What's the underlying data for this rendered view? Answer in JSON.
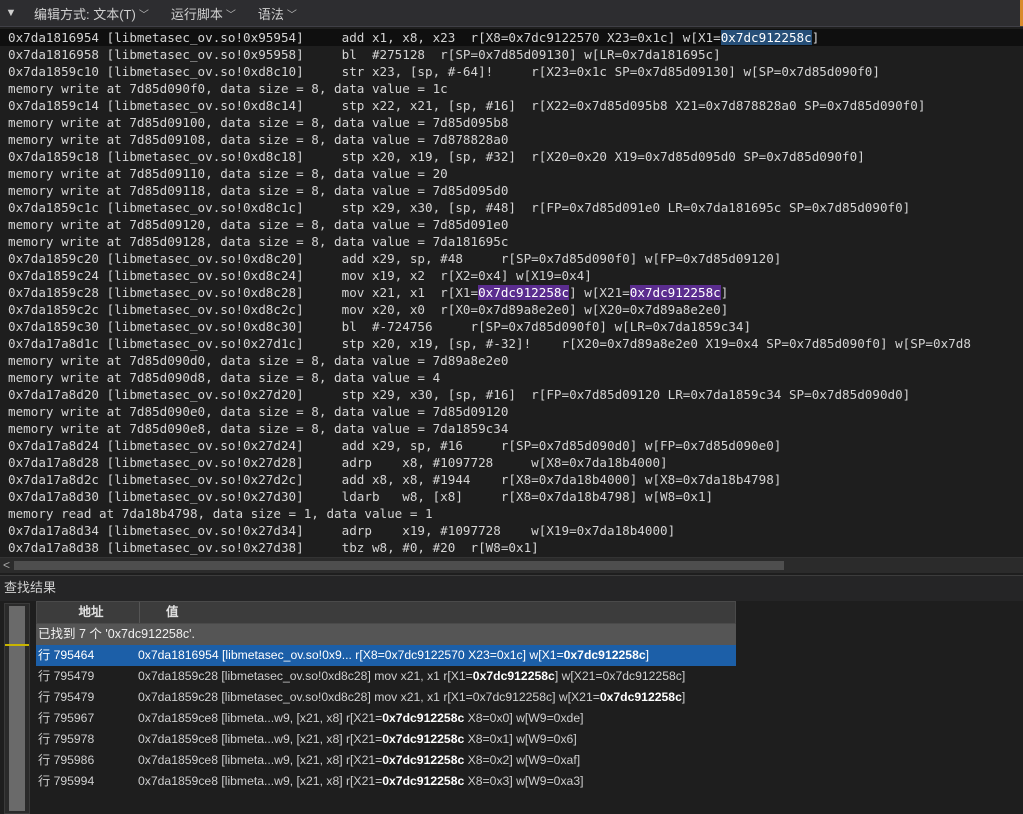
{
  "toolbar": {
    "collapse_glyph": "▼",
    "menus": [
      {
        "label": "编辑方式: 文本(T)",
        "icon": "chevron-down-icon"
      },
      {
        "label": "运行脚本",
        "icon": "chevron-down-icon"
      },
      {
        "label": "语法",
        "icon": "chevron-down-icon"
      }
    ]
  },
  "editor": {
    "lines": [
      {
        "pre": "0x7da1816954 [libmetasec_ov.so!0x95954]     add x1, x8, x23  r[X8=0x7dc9122570 X23=0x1c] w[X1=",
        "sel": "0x7dc912258c",
        "post": "]"
      },
      {
        "text": "0x7da1816958 [libmetasec_ov.so!0x95958]     bl  #275128  r[SP=0x7d85d09130] w[LR=0x7da181695c]"
      },
      {
        "text": "0x7da1859c10 [libmetasec_ov.so!0xd8c10]     str x23, [sp, #-64]!     r[X23=0x1c SP=0x7d85d09130] w[SP=0x7d85d090f0]"
      },
      {
        "text": "memory write at 7d85d090f0, data size = 8, data value = 1c"
      },
      {
        "text": "0x7da1859c14 [libmetasec_ov.so!0xd8c14]     stp x22, x21, [sp, #16]  r[X22=0x7d85d095b8 X21=0x7d878828a0 SP=0x7d85d090f0]"
      },
      {
        "text": "memory write at 7d85d09100, data size = 8, data value = 7d85d095b8"
      },
      {
        "text": "memory write at 7d85d09108, data size = 8, data value = 7d878828a0"
      },
      {
        "text": "0x7da1859c18 [libmetasec_ov.so!0xd8c18]     stp x20, x19, [sp, #32]  r[X20=0x20 X19=0x7d85d095d0 SP=0x7d85d090f0]"
      },
      {
        "text": "memory write at 7d85d09110, data size = 8, data value = 20"
      },
      {
        "text": "memory write at 7d85d09118, data size = 8, data value = 7d85d095d0"
      },
      {
        "text": "0x7da1859c1c [libmetasec_ov.so!0xd8c1c]     stp x29, x30, [sp, #48]  r[FP=0x7d85d091e0 LR=0x7da181695c SP=0x7d85d090f0]"
      },
      {
        "text": "memory write at 7d85d09120, data size = 8, data value = 7d85d091e0"
      },
      {
        "text": "memory write at 7d85d09128, data size = 8, data value = 7da181695c"
      },
      {
        "text": "0x7da1859c20 [libmetasec_ov.so!0xd8c20]     add x29, sp, #48     r[SP=0x7d85d090f0] w[FP=0x7d85d09120]"
      },
      {
        "text": "0x7da1859c24 [libmetasec_ov.so!0xd8c24]     mov x19, x2  r[X2=0x4] w[X19=0x4]"
      },
      {
        "pre": "0x7da1859c28 [libmetasec_ov.so!0xd8c28]     mov x21, x1  r[X1=",
        "match": "0x7dc912258c",
        "mid": "] w[X21=",
        "match2": "0x7dc912258c",
        "post": "]"
      },
      {
        "text": "0x7da1859c2c [libmetasec_ov.so!0xd8c2c]     mov x20, x0  r[X0=0x7d89a8e2e0] w[X20=0x7d89a8e2e0]"
      },
      {
        "text": "0x7da1859c30 [libmetasec_ov.so!0xd8c30]     bl  #-724756     r[SP=0x7d85d090f0] w[LR=0x7da1859c34]"
      },
      {
        "text": "0x7da17a8d1c [libmetasec_ov.so!0x27d1c]     stp x20, x19, [sp, #-32]!    r[X20=0x7d89a8e2e0 X19=0x4 SP=0x7d85d090f0] w[SP=0x7d8"
      },
      {
        "text": "memory write at 7d85d090d0, data size = 8, data value = 7d89a8e2e0"
      },
      {
        "text": "memory write at 7d85d090d8, data size = 8, data value = 4"
      },
      {
        "text": "0x7da17a8d20 [libmetasec_ov.so!0x27d20]     stp x29, x30, [sp, #16]  r[FP=0x7d85d09120 LR=0x7da1859c34 SP=0x7d85d090d0]"
      },
      {
        "text": "memory write at 7d85d090e0, data size = 8, data value = 7d85d09120"
      },
      {
        "text": "memory write at 7d85d090e8, data size = 8, data value = 7da1859c34"
      },
      {
        "text": "0x7da17a8d24 [libmetasec_ov.so!0x27d24]     add x29, sp, #16     r[SP=0x7d85d090d0] w[FP=0x7d85d090e0]"
      },
      {
        "text": "0x7da17a8d28 [libmetasec_ov.so!0x27d28]     adrp    x8, #1097728     w[X8=0x7da18b4000]"
      },
      {
        "text": "0x7da17a8d2c [libmetasec_ov.so!0x27d2c]     add x8, x8, #1944    r[X8=0x7da18b4000] w[X8=0x7da18b4798]"
      },
      {
        "text": "0x7da17a8d30 [libmetasec_ov.so!0x27d30]     ldarb   w8, [x8]     r[X8=0x7da18b4798] w[W8=0x1]"
      },
      {
        "text": "memory read at 7da18b4798, data size = 1, data value = 1"
      },
      {
        "text": "0x7da17a8d34 [libmetasec_ov.so!0x27d34]     adrp    x19, #1097728    w[X19=0x7da18b4000]"
      },
      {
        "text": "0x7da17a8d38 [libmetasec_ov.so!0x27d38]     tbz w8, #0, #20  r[W8=0x1]"
      }
    ]
  },
  "find_results": {
    "title": "查找结果",
    "col_address": "地址",
    "col_value": "值",
    "summary": "已找到 7 个 '0x7dc912258c'.",
    "rows": [
      {
        "line": "行 795464",
        "pre": "0x7da1816954 [libmetasec_ov.so!0x9... r[X8=0x7dc9122570 X23=0x1c] w[X1=",
        "bold": "0x7dc912258c",
        "post": "]",
        "selected": true
      },
      {
        "line": "行 795479",
        "pre": "0x7da1859c28 [libmetasec_ov.so!0xd8c28]  mov x21, x1  r[X1=",
        "bold": "0x7dc912258c",
        "post": "] w[X21=0x7dc912258c]"
      },
      {
        "line": "行 795479",
        "pre": "0x7da1859c28 [libmetasec_ov.so!0xd8c28]  mov x21, x1  r[X1=0x7dc912258c] w[X21=",
        "bold": "0x7dc912258c",
        "post": "]"
      },
      {
        "line": "行 795967",
        "pre": "0x7da1859ce8 [libmeta...w9, [x21, x8]  r[X21=",
        "bold": "0x7dc912258c",
        "post": " X8=0x0] w[W9=0xde]"
      },
      {
        "line": "行 795978",
        "pre": "0x7da1859ce8 [libmeta...w9, [x21, x8]  r[X21=",
        "bold": "0x7dc912258c",
        "post": " X8=0x1] w[W9=0x6]"
      },
      {
        "line": "行 795986",
        "pre": "0x7da1859ce8 [libmeta...w9, [x21, x8]  r[X21=",
        "bold": "0x7dc912258c",
        "post": " X8=0x2] w[W9=0xaf]"
      },
      {
        "line": "行 795994",
        "pre": "0x7da1859ce8 [libmeta...w9, [x21, x8]  r[X21=",
        "bold": "0x7dc912258c",
        "post": " X8=0x3] w[W9=0xa3]"
      }
    ]
  },
  "scrollbar": {
    "left_arrow": "<"
  },
  "colors": {
    "selection": "#264f78",
    "match": "#5b2d8f",
    "selected_row": "#1c5fa8"
  }
}
